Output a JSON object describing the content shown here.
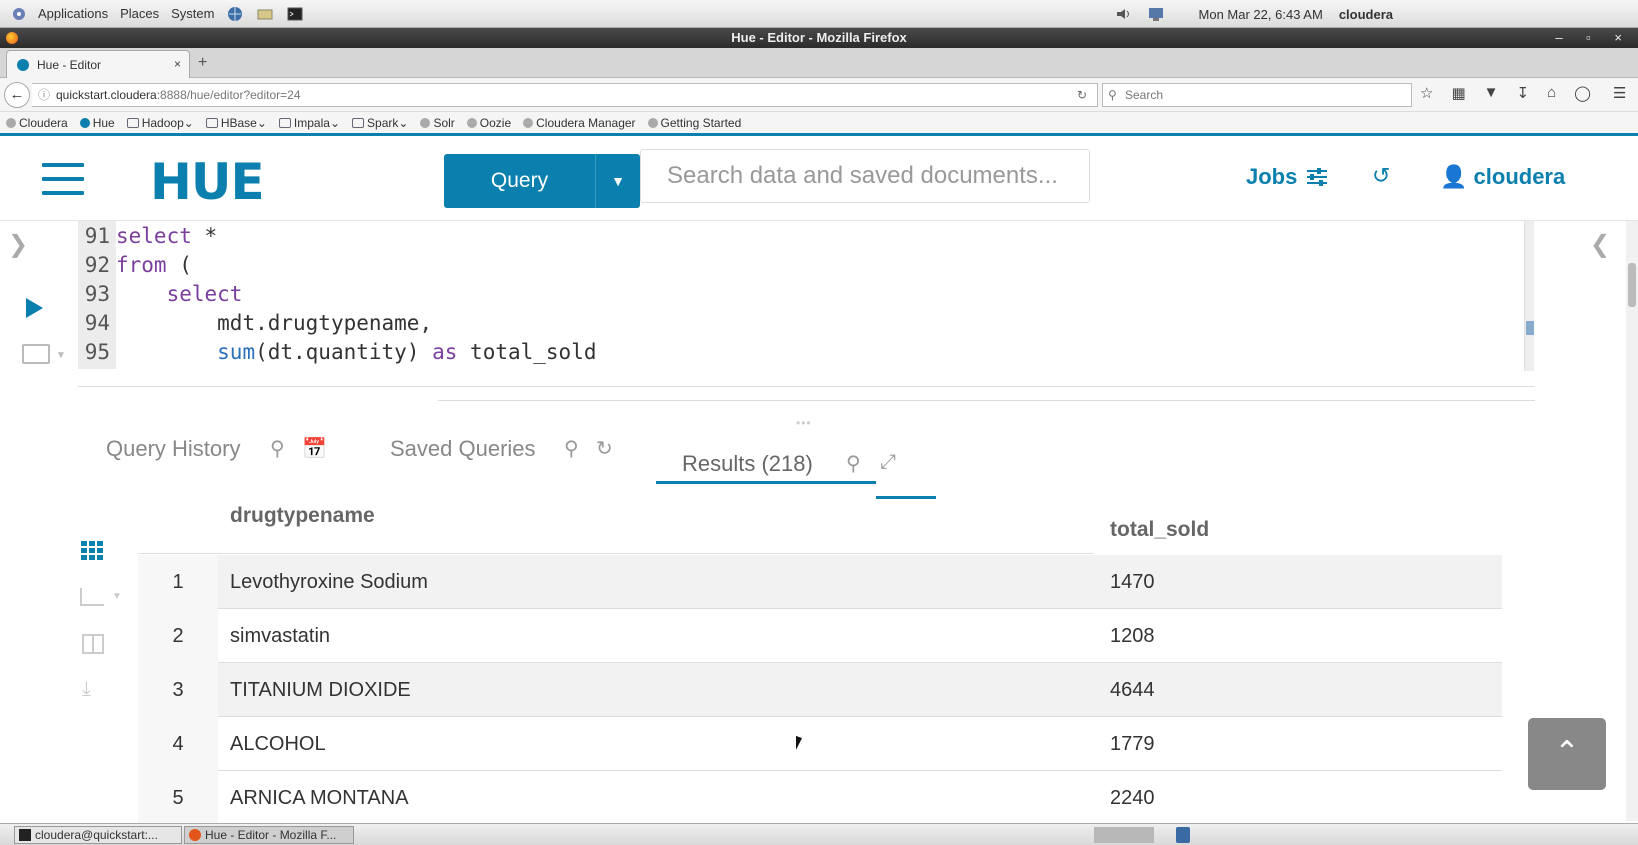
{
  "os_panel": {
    "applications": "Applications",
    "places": "Places",
    "system": "System",
    "datetime": "Mon Mar 22,  6:43 AM",
    "user": "cloudera"
  },
  "window": {
    "title": "Hue - Editor - Mozilla Firefox",
    "controls": "– ▫ ×"
  },
  "browser": {
    "tab_title": "Hue - Editor",
    "tab_close": "×",
    "new_tab": "+",
    "url_host": "quickstart.cloudera",
    "url_path": ":8888/hue/editor?editor=24",
    "search_placeholder": "Search",
    "bookmarks": [
      {
        "label": "Cloudera"
      },
      {
        "label": "Hue"
      },
      {
        "label": "Hadoop"
      },
      {
        "label": "HBase"
      },
      {
        "label": "Impala"
      },
      {
        "label": "Spark"
      },
      {
        "label": "Solr"
      },
      {
        "label": "Oozie"
      },
      {
        "label": "Cloudera Manager"
      },
      {
        "label": "Getting Started"
      }
    ]
  },
  "hue_header": {
    "logo": "HUE",
    "query_button": "Query",
    "search_placeholder": "Search data and saved documents...",
    "jobs": "Jobs",
    "user": "cloudera"
  },
  "editor": {
    "lines": [
      {
        "n": "91",
        "indent": "",
        "parts": [
          {
            "t": "select",
            "c": "kw"
          },
          {
            "t": " *",
            "c": "tx"
          }
        ]
      },
      {
        "n": "92",
        "indent": "",
        "parts": [
          {
            "t": "from",
            "c": "kw"
          },
          {
            "t": " (",
            "c": "tx"
          }
        ]
      },
      {
        "n": "93",
        "indent": "    ",
        "parts": [
          {
            "t": "select",
            "c": "kw"
          }
        ]
      },
      {
        "n": "94",
        "indent": "        ",
        "parts": [
          {
            "t": "mdt.drugtypename,",
            "c": "tx"
          }
        ]
      },
      {
        "n": "95",
        "indent": "        ",
        "parts": [
          {
            "t": "sum",
            "c": "fn"
          },
          {
            "t": "(dt.quantity) ",
            "c": "tx"
          },
          {
            "t": "as",
            "c": "kw"
          },
          {
            "t": " total_sold",
            "c": "tx"
          }
        ]
      }
    ]
  },
  "results_tabs": {
    "query_history": "Query History",
    "saved_queries": "Saved Queries",
    "results": "Results (218)"
  },
  "results_table": {
    "columns": [
      "drugtypename",
      "total_sold"
    ],
    "rows": [
      {
        "n": "1",
        "drugtypename": "Levothyroxine Sodium",
        "total_sold": "1470"
      },
      {
        "n": "2",
        "drugtypename": "simvastatin",
        "total_sold": "1208"
      },
      {
        "n": "3",
        "drugtypename": "TITANIUM DIOXIDE",
        "total_sold": "4644"
      },
      {
        "n": "4",
        "drugtypename": "ALCOHOL",
        "total_sold": "1779"
      },
      {
        "n": "5",
        "drugtypename": "ARNICA MONTANA",
        "total_sold": "2240"
      }
    ]
  },
  "taskbar": {
    "items": [
      {
        "label": "cloudera@quickstart:..."
      },
      {
        "label": "Hue - Editor - Mozilla F..."
      }
    ]
  },
  "colors": {
    "hue_blue": "#0B7FAD",
    "keyword": "#7a3e9d",
    "function": "#2a6fb8"
  },
  "icons": {
    "run": "play-icon",
    "search": "search-icon",
    "calendar": "calendar-icon",
    "refresh": "refresh-icon",
    "expand": "expand-icon",
    "history": "history-icon",
    "user": "user-icon",
    "jobs": "sliders-icon"
  }
}
